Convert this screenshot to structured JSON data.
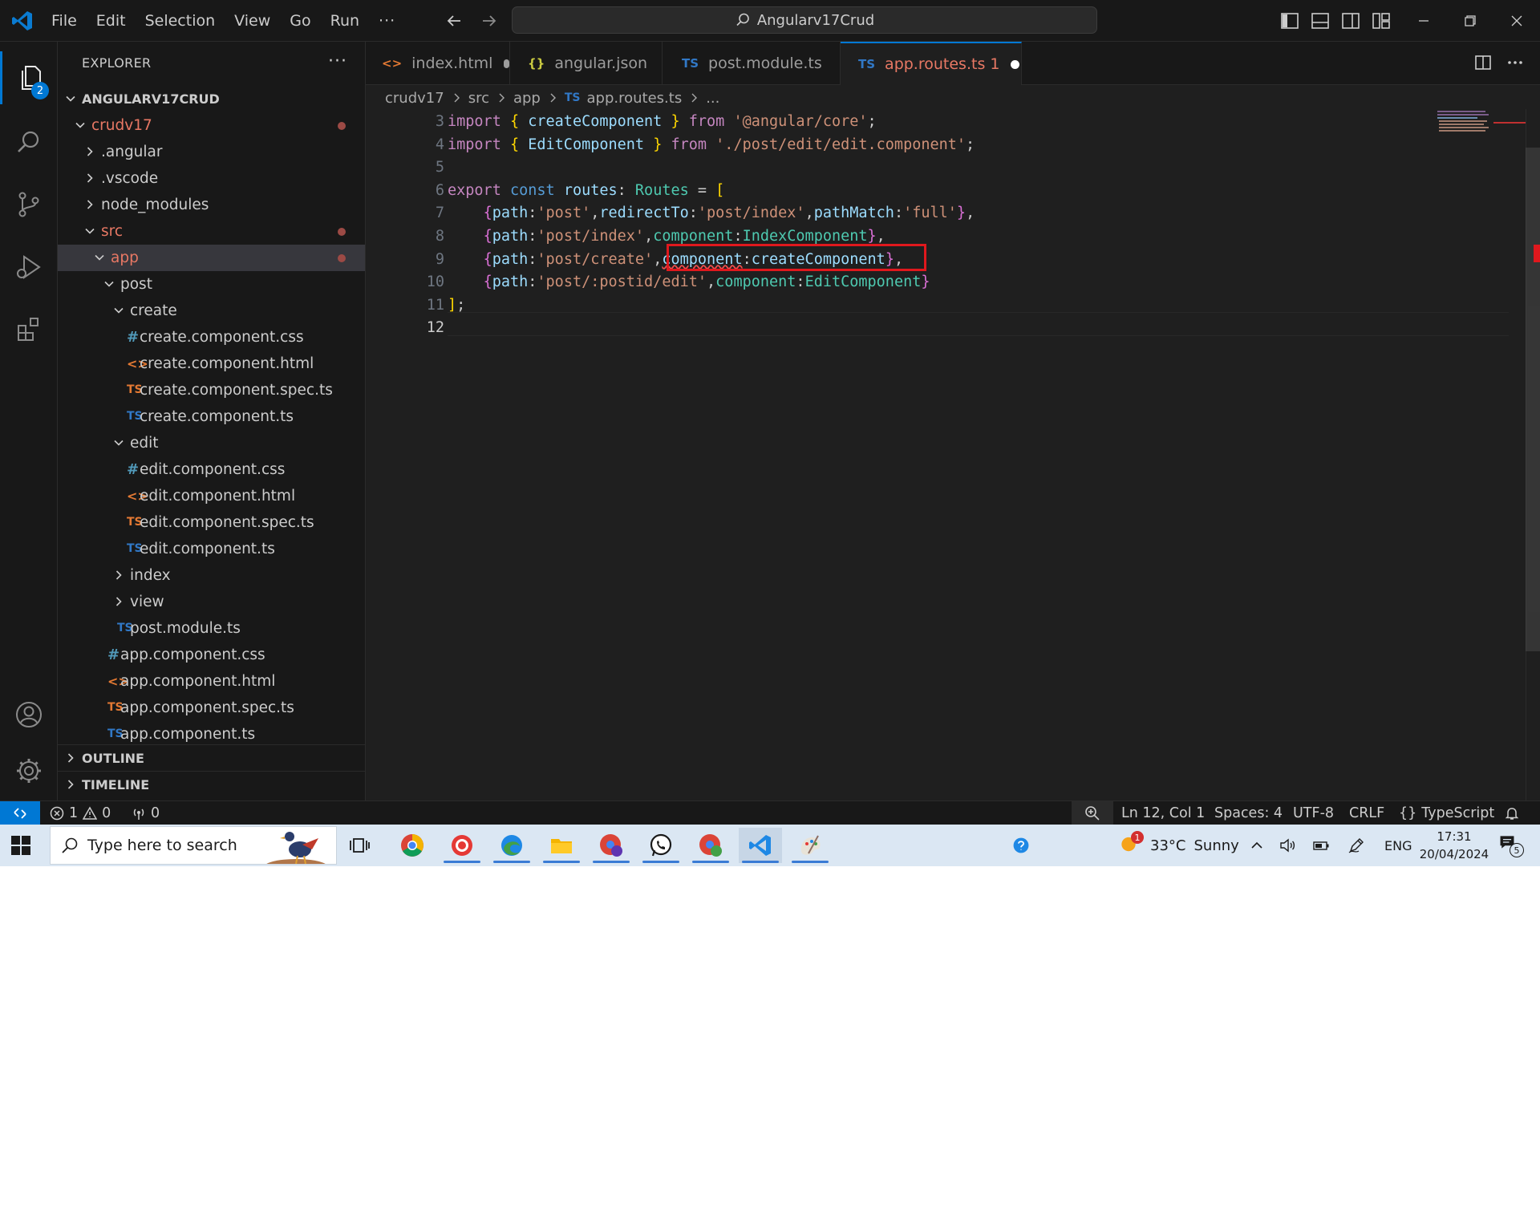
{
  "titlebar": {
    "menu": [
      "File",
      "Edit",
      "Selection",
      "View",
      "Go",
      "Run"
    ],
    "more": "···",
    "command_center": "Angularv17Crud"
  },
  "activity": {
    "explorer_badge": "2"
  },
  "explorer": {
    "header": "EXPLORER",
    "more": "···",
    "root": "ANGULARV17CRUD",
    "tree": [
      {
        "label": "crudv17",
        "indent": 1,
        "type": "folder-open",
        "modified": true
      },
      {
        "label": ".angular",
        "indent": 2,
        "type": "folder-closed"
      },
      {
        "label": ".vscode",
        "indent": 2,
        "type": "folder-closed"
      },
      {
        "label": "node_modules",
        "indent": 2,
        "type": "folder-closed"
      },
      {
        "label": "src",
        "indent": 2,
        "type": "folder-open",
        "modified": true
      },
      {
        "label": "app",
        "indent": 3,
        "type": "folder-open",
        "modified": true,
        "selected": true
      },
      {
        "label": "post",
        "indent": 4,
        "type": "folder-open"
      },
      {
        "label": "create",
        "indent": 5,
        "type": "folder-open"
      },
      {
        "label": "create.component.css",
        "indent": 6,
        "type": "css"
      },
      {
        "label": "create.component.html",
        "indent": 6,
        "type": "html"
      },
      {
        "label": "create.component.spec.ts",
        "indent": 6,
        "type": "spec"
      },
      {
        "label": "create.component.ts",
        "indent": 6,
        "type": "ts"
      },
      {
        "label": "edit",
        "indent": 5,
        "type": "folder-open"
      },
      {
        "label": "edit.component.css",
        "indent": 6,
        "type": "css"
      },
      {
        "label": "edit.component.html",
        "indent": 6,
        "type": "html"
      },
      {
        "label": "edit.component.spec.ts",
        "indent": 6,
        "type": "spec"
      },
      {
        "label": "edit.component.ts",
        "indent": 6,
        "type": "ts"
      },
      {
        "label": "index",
        "indent": 5,
        "type": "folder-closed"
      },
      {
        "label": "view",
        "indent": 5,
        "type": "folder-closed"
      },
      {
        "label": "post.module.ts",
        "indent": 5,
        "type": "ts"
      },
      {
        "label": "app.component.css",
        "indent": 4,
        "type": "css"
      },
      {
        "label": "app.component.html",
        "indent": 4,
        "type": "html"
      },
      {
        "label": "app.component.spec.ts",
        "indent": 4,
        "type": "spec"
      },
      {
        "label": "app.component.ts",
        "indent": 4,
        "type": "ts"
      }
    ],
    "sections": [
      "OUTLINE",
      "TIMELINE"
    ]
  },
  "tabs": [
    {
      "icon": "<>",
      "label": "index.html",
      "dirty": true
    },
    {
      "icon": "{}",
      "label": "angular.json",
      "dirty": false
    },
    {
      "icon": "TS",
      "label": "post.module.ts",
      "dirty": false
    },
    {
      "icon": "TS",
      "label": "app.routes.ts 1",
      "dirty": true,
      "active": true
    }
  ],
  "breadcrumb": {
    "parts": [
      "crudv17",
      "src",
      "app"
    ],
    "file_icon": "TS",
    "file": "app.routes.ts",
    "tail": "..."
  },
  "editor": {
    "line_numbers": [
      "3",
      "4",
      "5",
      "6",
      "7",
      "8",
      "9",
      "10",
      "11",
      "12"
    ],
    "current_line": "12",
    "lines": [
      [
        [
          "kw",
          "import"
        ],
        [
          "pun",
          " "
        ],
        [
          "br1",
          "{"
        ],
        [
          "pun",
          " "
        ],
        [
          "var",
          "createComponent"
        ],
        [
          "pun",
          " "
        ],
        [
          "br1",
          "}"
        ],
        [
          "pun",
          " "
        ],
        [
          "kw",
          "from"
        ],
        [
          "pun",
          " "
        ],
        [
          "str",
          "'@angular/core'"
        ],
        [
          "pun",
          ";"
        ]
      ],
      [
        [
          "kw",
          "import"
        ],
        [
          "pun",
          " "
        ],
        [
          "br1",
          "{"
        ],
        [
          "pun",
          " "
        ],
        [
          "var",
          "EditComponent"
        ],
        [
          "pun",
          " "
        ],
        [
          "br1",
          "}"
        ],
        [
          "pun",
          " "
        ],
        [
          "kw",
          "from"
        ],
        [
          "pun",
          " "
        ],
        [
          "str",
          "'./post/edit/edit.component'"
        ],
        [
          "pun",
          ";"
        ]
      ],
      [],
      [
        [
          "kw",
          "export"
        ],
        [
          "pun",
          " "
        ],
        [
          "kw2",
          "const"
        ],
        [
          "pun",
          " "
        ],
        [
          "var",
          "routes"
        ],
        [
          "pun",
          ": "
        ],
        [
          "typ",
          "Routes"
        ],
        [
          "pun",
          " = "
        ],
        [
          "br1",
          "["
        ]
      ],
      [
        [
          "pun",
          "    "
        ],
        [
          "br2",
          "{"
        ],
        [
          "var",
          "path"
        ],
        [
          "pun",
          ":"
        ],
        [
          "str",
          "'post'"
        ],
        [
          "pun",
          ","
        ],
        [
          "var",
          "redirectTo"
        ],
        [
          "pun",
          ":"
        ],
        [
          "str",
          "'post/index'"
        ],
        [
          "pun",
          ","
        ],
        [
          "var",
          "pathMatch"
        ],
        [
          "pun",
          ":"
        ],
        [
          "str",
          "'full'"
        ],
        [
          "br2",
          "}"
        ],
        [
          "pun",
          ","
        ]
      ],
      [
        [
          "pun",
          "    "
        ],
        [
          "br2",
          "{"
        ],
        [
          "var",
          "path"
        ],
        [
          "pun",
          ":"
        ],
        [
          "str",
          "'post/index'"
        ],
        [
          "pun",
          ","
        ],
        [
          "typ",
          "component"
        ],
        [
          "pun",
          ":"
        ],
        [
          "typ",
          "IndexComponent"
        ],
        [
          "br2",
          "}"
        ],
        [
          "pun",
          ","
        ]
      ],
      [
        [
          "pun",
          "    "
        ],
        [
          "br2",
          "{"
        ],
        [
          "var",
          "path"
        ],
        [
          "pun",
          ":"
        ],
        [
          "str",
          "'post/create'"
        ],
        [
          "pun",
          ","
        ],
        [
          "var err",
          "component"
        ],
        [
          "pun",
          ":"
        ],
        [
          "var",
          "createComponent"
        ],
        [
          "br2",
          "}"
        ],
        [
          "pun",
          ","
        ]
      ],
      [
        [
          "pun",
          "    "
        ],
        [
          "br2",
          "{"
        ],
        [
          "var",
          "path"
        ],
        [
          "pun",
          ":"
        ],
        [
          "str",
          "'post/:postid/edit'"
        ],
        [
          "pun",
          ","
        ],
        [
          "typ",
          "component"
        ],
        [
          "pun",
          ":"
        ],
        [
          "typ",
          "EditComponent"
        ],
        [
          "br2",
          "}"
        ]
      ],
      [
        [
          "br1",
          "]"
        ],
        [
          "pun",
          ";"
        ]
      ],
      []
    ]
  },
  "statusbar": {
    "errors": "1",
    "warnings": "0",
    "ports": "0",
    "position": "Ln 12, Col 1",
    "spaces": "Spaces: 4",
    "encoding": "UTF-8",
    "eol": "CRLF",
    "lang_icon": "{}",
    "language": "TypeScript"
  },
  "taskbar": {
    "search_placeholder": "Type here to search",
    "weather_temp": "33°C",
    "weather_desc": "Sunny",
    "weather_badge": "1",
    "lang": "ENG",
    "time": "17:31",
    "date": "20/04/2024",
    "notif_count": "5"
  }
}
